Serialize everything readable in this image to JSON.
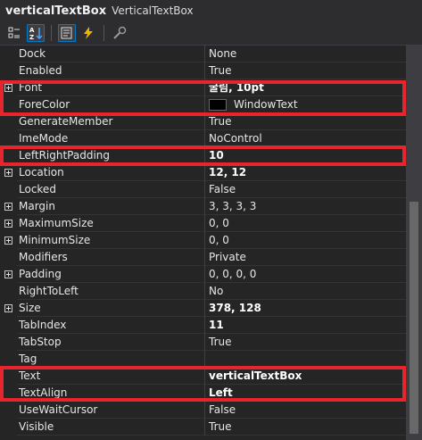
{
  "header": {
    "object_name": "verticalTextBox",
    "object_type": "VerticalTextBox"
  },
  "toolbar": {
    "buttons": [
      "categorized-icon",
      "alphabetical-icon",
      "properties-icon",
      "events-icon",
      "property-pages-icon"
    ]
  },
  "properties": [
    {
      "name": "Dock",
      "value": "None",
      "bold": false,
      "expandable": false
    },
    {
      "name": "Enabled",
      "value": "True",
      "bold": false,
      "expandable": false
    },
    {
      "name": "Font",
      "value": "굴림, 10pt",
      "bold": true,
      "expandable": true
    },
    {
      "name": "ForeColor",
      "value": "WindowText",
      "bold": false,
      "expandable": false,
      "swatch": "#000000"
    },
    {
      "name": "GenerateMember",
      "value": "True",
      "bold": false,
      "expandable": false
    },
    {
      "name": "ImeMode",
      "value": "NoControl",
      "bold": false,
      "expandable": false
    },
    {
      "name": "LeftRightPadding",
      "value": "10",
      "bold": true,
      "expandable": false
    },
    {
      "name": "Location",
      "value": "12, 12",
      "bold": true,
      "expandable": true
    },
    {
      "name": "Locked",
      "value": "False",
      "bold": false,
      "expandable": false
    },
    {
      "name": "Margin",
      "value": "3, 3, 3, 3",
      "bold": false,
      "expandable": true
    },
    {
      "name": "MaximumSize",
      "value": "0, 0",
      "bold": false,
      "expandable": true
    },
    {
      "name": "MinimumSize",
      "value": "0, 0",
      "bold": false,
      "expandable": true
    },
    {
      "name": "Modifiers",
      "value": "Private",
      "bold": false,
      "expandable": false
    },
    {
      "name": "Padding",
      "value": "0, 0, 0, 0",
      "bold": false,
      "expandable": true
    },
    {
      "name": "RightToLeft",
      "value": "No",
      "bold": false,
      "expandable": false
    },
    {
      "name": "Size",
      "value": "378, 128",
      "bold": true,
      "expandable": true
    },
    {
      "name": "TabIndex",
      "value": "11",
      "bold": true,
      "expandable": false
    },
    {
      "name": "TabStop",
      "value": "True",
      "bold": false,
      "expandable": false
    },
    {
      "name": "Tag",
      "value": "",
      "bold": false,
      "expandable": false
    },
    {
      "name": "Text",
      "value": "verticalTextBox",
      "bold": true,
      "expandable": false
    },
    {
      "name": "TextAlign",
      "value": "Left",
      "bold": true,
      "expandable": false
    },
    {
      "name": "UseWaitCursor",
      "value": "False",
      "bold": false,
      "expandable": false
    },
    {
      "name": "Visible",
      "value": "True",
      "bold": false,
      "expandable": false
    }
  ],
  "colors": {
    "highlight": "#e8242c",
    "background": "#252526",
    "header": "#2d2d30"
  }
}
